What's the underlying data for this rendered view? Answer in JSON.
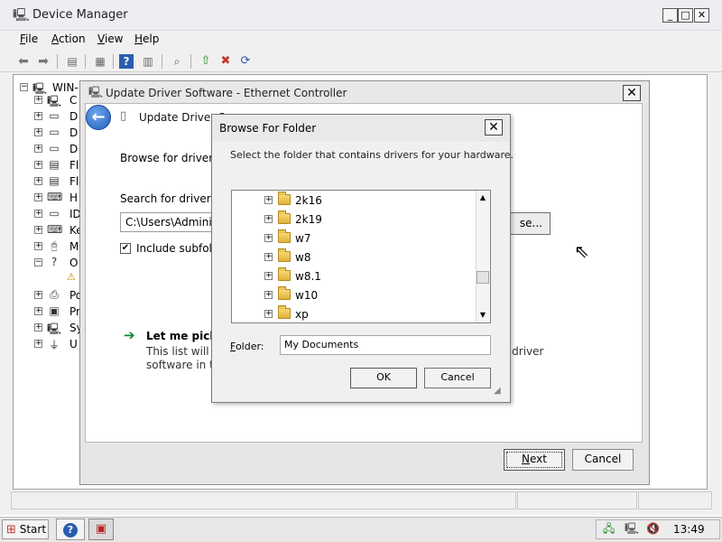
{
  "device_manager": {
    "title": "Device Manager",
    "menu": {
      "file": {
        "key": "F",
        "rest": "ile"
      },
      "action": {
        "key": "A",
        "rest": "ction"
      },
      "view": {
        "key": "V",
        "rest": "iew"
      },
      "help": {
        "key": "H",
        "rest": "elp"
      }
    },
    "tree_root": "WIN-",
    "tree_items": [
      "C",
      "D",
      "D",
      "D",
      "Fl",
      "Fl",
      "H",
      "ID",
      "Ke",
      "M",
      "O",
      "Po",
      "Pr",
      "Sy",
      "U"
    ]
  },
  "update_driver": {
    "title": "Update Driver Software - Ethernet Controller",
    "heading": "Update Driver S",
    "browse_text": "Browse for driver so",
    "search_label": "Search for driver so",
    "path_value": "C:\\Users\\Administ",
    "browse_button": "se...",
    "include_subfolders": "Include subfold",
    "include_checked": true,
    "pick_title": "Let me pick f",
    "pick_line1": "This list will sl",
    "pick_line2": "software in th",
    "pick_tail": "l driver",
    "next_key": "N",
    "next_rest": "ext",
    "cancel": "Cancel"
  },
  "browse_folder": {
    "title": "Browse For Folder",
    "instructions": "Select the folder that contains drivers for your hardware.",
    "folders": [
      "2k16",
      "2k19",
      "w7",
      "w8",
      "w8.1",
      "w10",
      "xp"
    ],
    "folder_label_key": "F",
    "folder_label_rest": "older:",
    "folder_value": "My Documents",
    "ok": "OK",
    "cancel": "Cancel"
  },
  "taskbar": {
    "start": "Start",
    "clock": "13:49"
  }
}
